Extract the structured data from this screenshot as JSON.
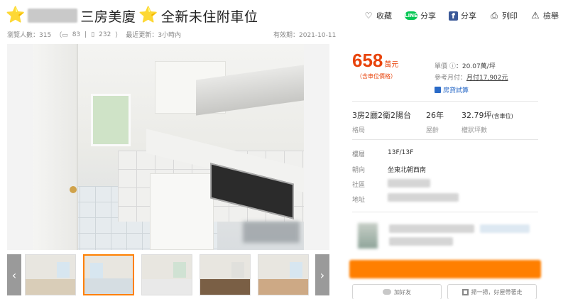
{
  "title": {
    "star_left": "⭐",
    "text_mid": "三房美廈",
    "star_mid": "⭐",
    "text_end": "全新未住附車位"
  },
  "actions": {
    "collect": "收藏",
    "share_line": "分享",
    "share_fb": "分享",
    "print": "列印",
    "report": "檢舉",
    "line_badge": "LINE",
    "fb_badge": "f"
  },
  "meta": {
    "views": "瀏覽人數：315",
    "comments": "83",
    "mobile": "232",
    "updated": "最近更新：3小時內",
    "valid": "有效期：2021-10-11"
  },
  "price": {
    "value": "658",
    "unit": "萬元",
    "note": "（含車位價格）",
    "unit_price_label": "單價",
    "unit_price_value": "：20.07萬/坪",
    "monthly_label": "參考月付：",
    "monthly_value": "月付17,902元",
    "loan_calc": "房貸試算"
  },
  "stats": {
    "layout": "3房2廳2衛2陽台",
    "layout_label": "格局",
    "age": "26年",
    "age_label": "屋齡",
    "size": "32.79坪",
    "size_note": "(含車位)",
    "size_label": "權狀坪數"
  },
  "info": {
    "floor_label": "樓層",
    "floor_value": "13F/13F",
    "orient_label": "朝向",
    "orient_value": "坐東北朝西南",
    "community_label": "社區",
    "address_label": "地址"
  },
  "buttons": {
    "add_friend": "加好友",
    "scan": "掃一掃，好屋帶著走"
  },
  "thumbs": {
    "prev": "‹",
    "next": "›"
  }
}
